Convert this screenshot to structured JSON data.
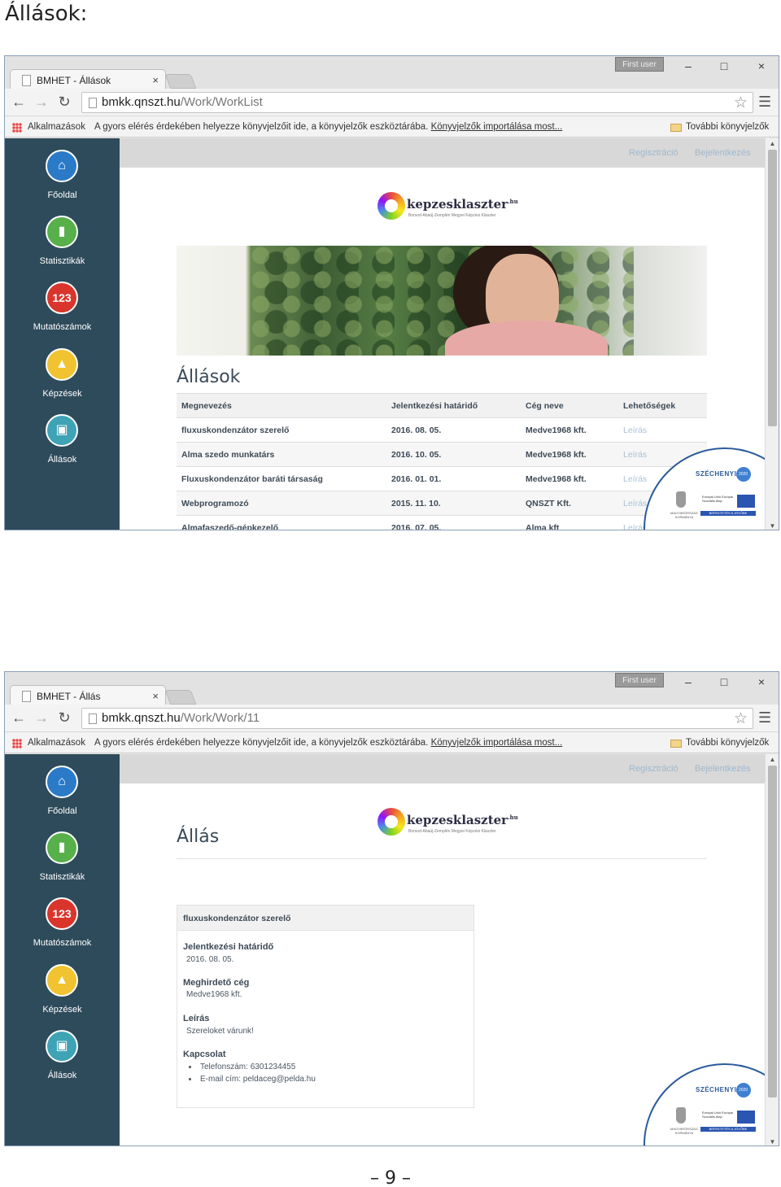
{
  "doc_heading": "Állások:",
  "page_number": "– 9 –",
  "browser_common": {
    "user": "First user",
    "minimize": "–",
    "maximize": "□",
    "close": "×",
    "tab_close": "×",
    "url_host": "bmkk.qnszt.hu",
    "apps_label": "Alkalmazások",
    "bookmark_hint": "A gyors elérés érdekében helyezze könyvjelzőit ide, a könyvjelzők eszköztárába.",
    "bookmark_import": "Könyvjelzők importálása most...",
    "other_bookmarks": "További könyvjelzők"
  },
  "site": {
    "nav": [
      {
        "label": "Főoldal",
        "icon": "home-icon",
        "color": "#2a7ac8"
      },
      {
        "label": "Statisztikák",
        "icon": "bar-chart-icon",
        "color": "#57b04a"
      },
      {
        "label": "Mutatószámok",
        "icon": "numbers-icon",
        "glyph": "123",
        "color": "#d9352c"
      },
      {
        "label": "Képzések",
        "icon": "graduation-cap-icon",
        "color": "#f1c331"
      },
      {
        "label": "Állások",
        "icon": "briefcase-icon",
        "color": "#3fa3b6"
      }
    ],
    "register": "Regisztráció",
    "login": "Bejelentkezés",
    "logo_text": "kepzesklaszter",
    "logo_sup": ".hu",
    "logo_sub": "Borsod-Abaúj-Zemplén Megyei Képzési Klaszter",
    "szechenyi": "SZÉCHENYI",
    "szechenyi_year": "2020",
    "eu_text": "Európai Unió Európai Szociális Alap",
    "eu_band": "BEFEKTETÉS A JÖVŐBE",
    "gov_text": "MAGYARORSZÁG KORMÁNYA"
  },
  "screen1": {
    "tab_title": "BMHET - Állások",
    "url_path": "/Work/WorkList",
    "page_title": "Állások",
    "table": {
      "headers": [
        "Megnevezés",
        "Jelentkezési határidő",
        "Cég neve",
        "Lehetőségek"
      ],
      "rows": [
        [
          "fluxuskondenzátor szerelő",
          "2016. 08. 05.",
          "Medve1968 kft.",
          "Leírás"
        ],
        [
          "Alma szedo munkatárs",
          "2016. 10. 05.",
          "Medve1968 kft.",
          "Leírás"
        ],
        [
          "Fluxuskondenzátor baráti társaság",
          "2016. 01. 01.",
          "Medve1968 kft.",
          "Leírás"
        ],
        [
          "Webprogramozó",
          "2015. 11. 10.",
          "QNSZT Kft.",
          "Leírás"
        ],
        [
          "Almafaszedő-gépkezelő",
          "2016. 07. 05.",
          "Alma kft",
          "Leírás"
        ]
      ]
    }
  },
  "screen2": {
    "tab_title": "BMHET - Állás",
    "url_path": "/Work/Work/11",
    "page_title": "Állás",
    "job_name": "fluxuskondenzátor szerelő",
    "deadline_label": "Jelentkezési határidő",
    "deadline_value": "2016. 08. 05.",
    "company_label": "Meghirdető cég",
    "company_value": "Medve1968 kft.",
    "description_label": "Leírás",
    "description_value": "Szereloket várunk!",
    "contact_label": "Kapcsolat",
    "contacts": [
      "Telefonszám: 6301234455",
      "E-mail cím: peldaceg@pelda.hu"
    ]
  }
}
